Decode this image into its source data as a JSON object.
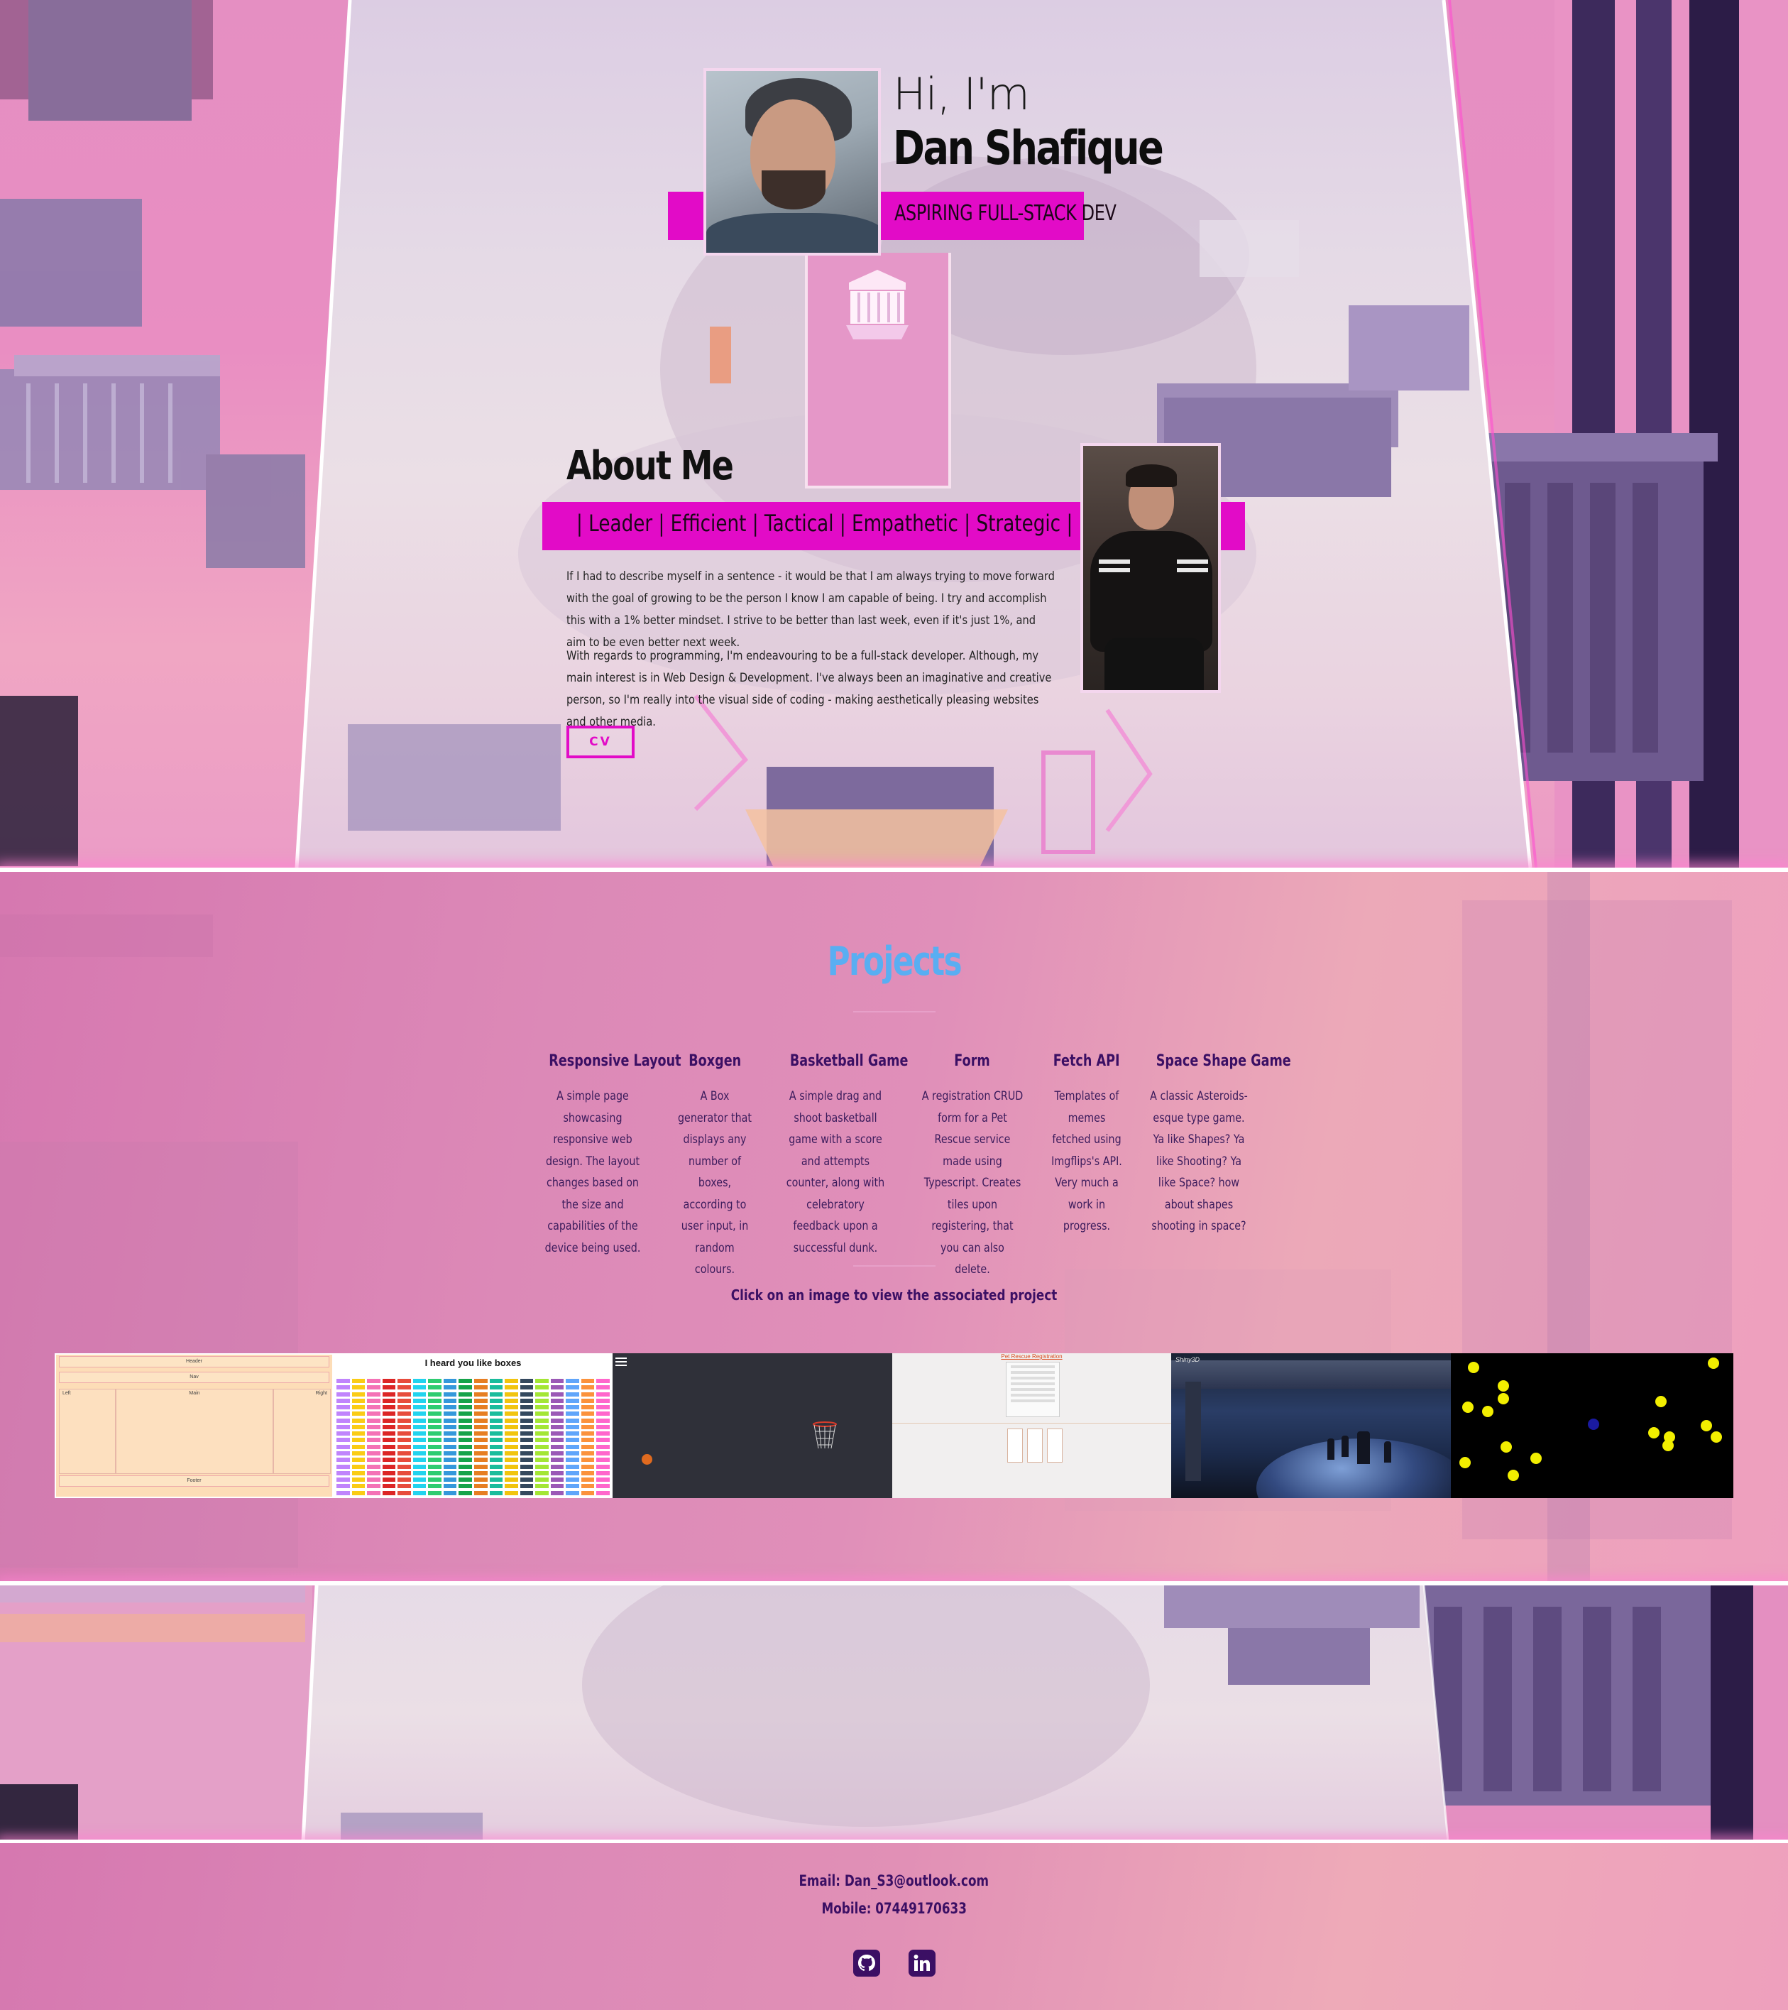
{
  "hero": {
    "greeting": "Hi, I'm",
    "name": "Dan Shafique",
    "tagline": "ASPIRING FULL-STACK DEV"
  },
  "about": {
    "title": "About Me",
    "traits": "| Leader | Efficient | Tactical | Empathetic | Strategic | ENTJ-T |",
    "paragraphs": [
      "If I had to describe myself in a sentence - it would be that I am always trying to move forward with the goal of growing to be the person I know I am capable of being. I try and accomplish this with a 1% better mindset. I strive to be better than last week, even if it's just 1%, and aim to be even better next week.",
      "With regards to programming, I'm endeavouring to be a full-stack developer. Although, my main interest is in Web Design & Development. I've always been an imaginative and creative person, so I'm really into the visual side of coding - making aesthetically pleasing websites and other media."
    ],
    "cv_label": "CV"
  },
  "projects": {
    "title": "Projects",
    "items": [
      {
        "name": "Responsive Layout",
        "desc": "A simple page showcasing responsive web design. The layout changes based on the size and capabilities of the device being used."
      },
      {
        "name": "Boxgen",
        "desc": "A Box generator that displays any number of boxes, according to user input, in random colours."
      },
      {
        "name": "Basketball Game",
        "desc": "A simple drag and shoot basketball game with a score and attempts counter, along with celebratory feedback upon a successful dunk."
      },
      {
        "name": "Form",
        "desc": "A registration CRUD form for a Pet Rescue service made using Typescript. Creates tiles upon registering, that you can also delete."
      },
      {
        "name": "Fetch API",
        "desc": "Templates of memes fetched using Imgflips's API. Very much a work in progress."
      },
      {
        "name": "Space Shape Game",
        "desc": "A classic Asteroids-esque type game. Ya like Shapes? Ya like Shooting? Ya like Space? how about shapes shooting in space?"
      }
    ],
    "click_hint": "Click on an image to view the associated project",
    "thumbs": {
      "layout": {
        "header": "Header",
        "nav": "Nav",
        "left": "Left",
        "main": "Main",
        "right": "Right",
        "footer": "Footer"
      },
      "boxgen_title": "I heard you like boxes",
      "form_title": "Pet Rescue Registration",
      "fetch_logo": "Shiny3D"
    }
  },
  "contact": {
    "email": "Email: Dan_S3@outlook.com",
    "mobile": "Mobile: 07449170633",
    "icons": [
      "github-icon",
      "linkedin-icon"
    ]
  },
  "colors": {
    "accent_magenta": "#e20bc7",
    "projects_title": "#59aef2",
    "deep_purple": "#3b0f64"
  }
}
